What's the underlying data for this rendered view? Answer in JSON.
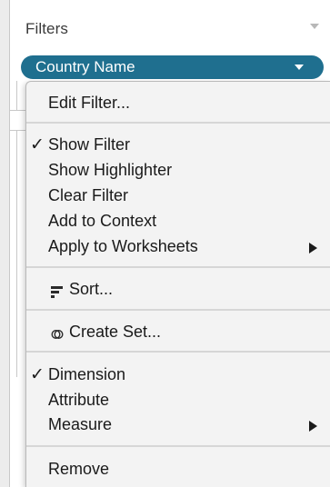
{
  "shelf": {
    "title": "Filters",
    "pill_label": "Country Name"
  },
  "menu": {
    "edit_filter": "Edit Filter...",
    "show_filter": "Show Filter",
    "show_highlighter": "Show Highlighter",
    "clear_filter": "Clear Filter",
    "add_to_context": "Add to Context",
    "apply_to_worksheets": "Apply to Worksheets",
    "sort": "Sort...",
    "create_set": "Create Set...",
    "dimension": "Dimension",
    "attribute": "Attribute",
    "measure": "Measure",
    "remove": "Remove",
    "check_glyph": "✓"
  },
  "state": {
    "show_filter_checked": true,
    "dimension_checked": true
  },
  "icons": {
    "sort": "sort-icon",
    "create_set": "set-icon",
    "submenu": "chevron-right-icon",
    "dropdown": "caret-down-icon"
  },
  "colors": {
    "pill": "#1f6f8f",
    "menu_bg": "#f3f3f3",
    "separator": "#d6d6d6"
  }
}
